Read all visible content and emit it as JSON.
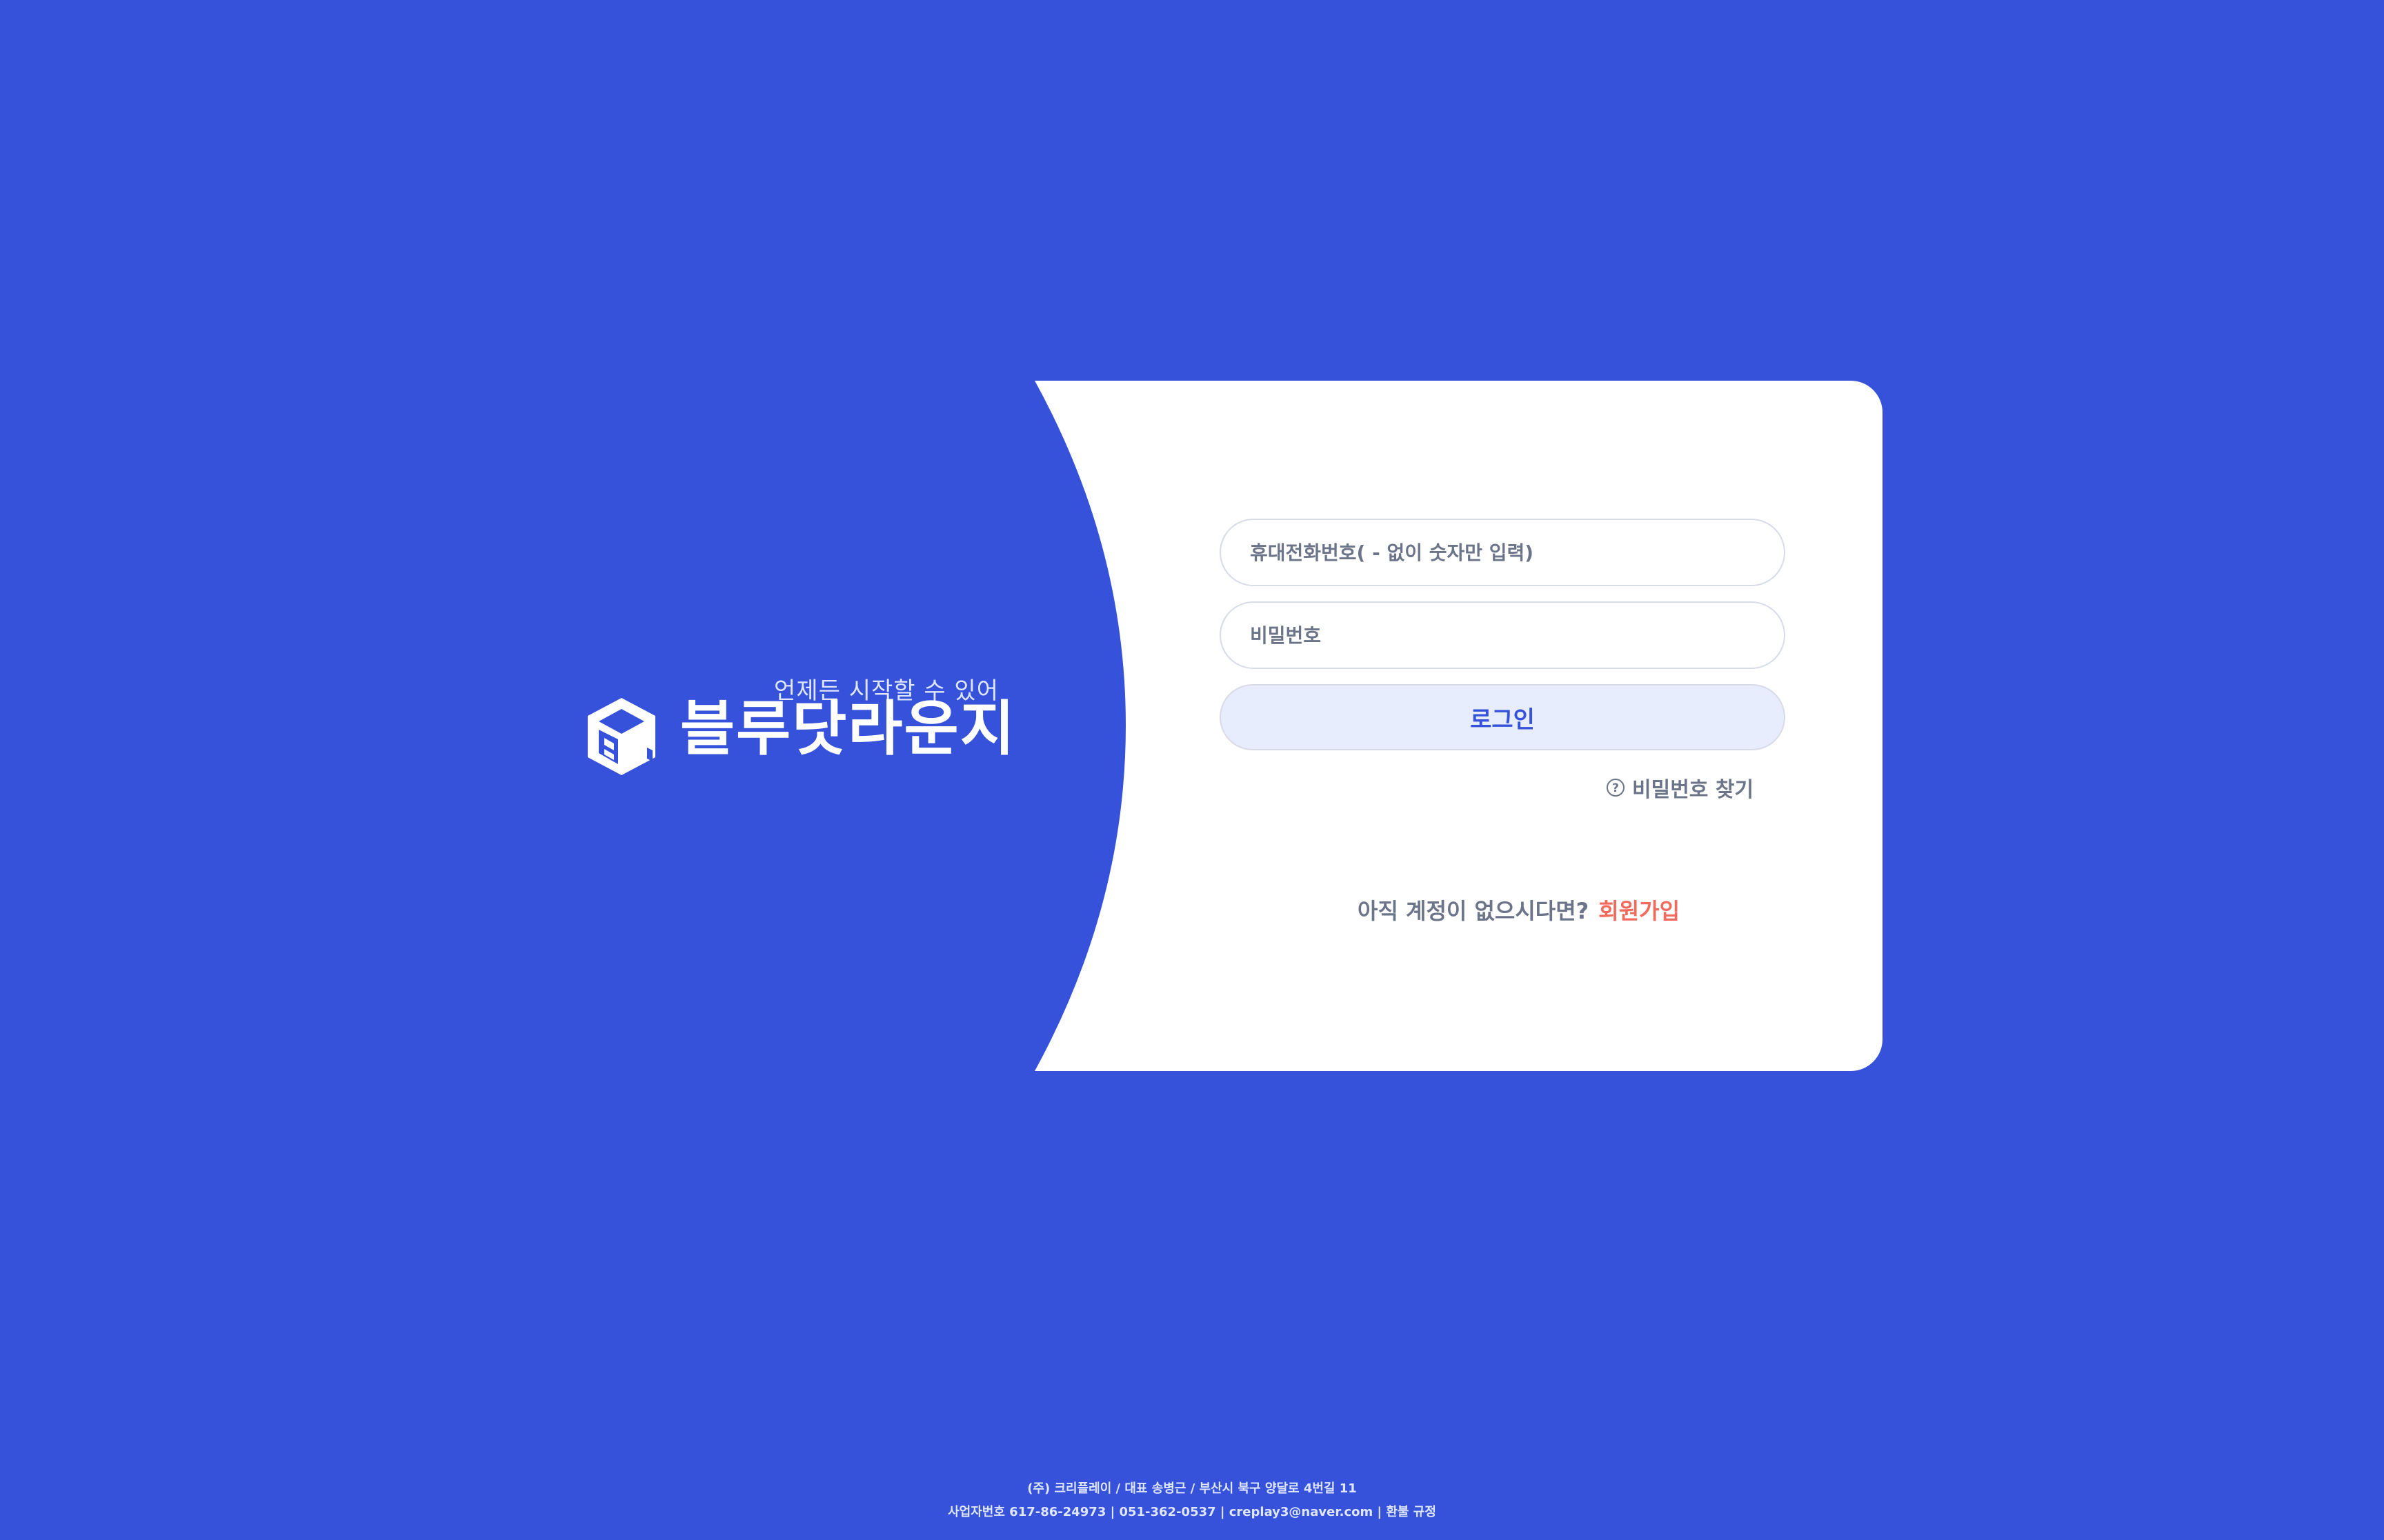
{
  "colors": {
    "background": "#3652da",
    "card_panel": "#ffffff",
    "accent": "#3652da",
    "button_bg": "#e8edfd",
    "signup_link": "#f16a5b",
    "muted_text": "#6b7489"
  },
  "brand": {
    "tagline": "언제든 시작할 수 있어",
    "name": "블루닷라운지",
    "logo_icon": "bluedot-cube-logo"
  },
  "login_form": {
    "phone_placeholder": "휴대전화번호( - 없이 숫자만 입력)",
    "password_placeholder": "비밀번호",
    "login_button": "로그인",
    "find_password": "비밀번호 찾기",
    "find_password_icon": "question-circle-icon"
  },
  "signup": {
    "prompt": "아직 계정이 없으시다면?",
    "link": "회원가입"
  },
  "footer": {
    "line1": "(주) 크리플레이 / 대표 송병근 / 부산시 북구 양달로 4번길 11",
    "line2": "사업자번호 617-86-24973 | 051-362-0537 | creplay3@naver.com | 환불 규정"
  }
}
